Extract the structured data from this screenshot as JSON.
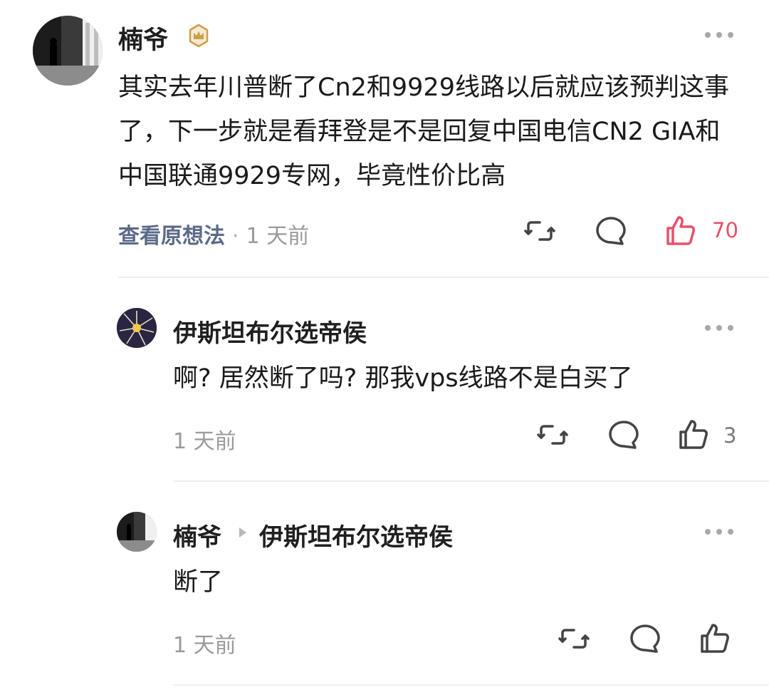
{
  "colors": {
    "text": "#1a1a1a",
    "muted": "#9a9a9a",
    "link": "#5b6a88",
    "liked": "#e8506b",
    "icon": "#444444",
    "badge_gold": "#c9a04a"
  },
  "comments": [
    {
      "author": "楠爷",
      "badge": "crown-badge-icon",
      "text": "其实去年川普断了Cn2和9929线路以后就应该预判这事了，下一步就是看拜登是不是回复中国电信CN2 GIA和中国联通9929专网，毕竟性价比高",
      "view_thought": "查看原想法",
      "separator": "·",
      "time": "1 天前",
      "likes": "70",
      "liked": true
    },
    {
      "author": "伊斯坦布尔选帝侯",
      "text": "啊? 居然断了吗? 那我vps线路不是白买了",
      "time": "1 天前",
      "likes": "3",
      "liked": false
    },
    {
      "author": "楠爷",
      "reply_to": "伊斯坦布尔选帝侯",
      "text": "断了",
      "time": "1 天前",
      "likes": "",
      "liked": false
    }
  ]
}
